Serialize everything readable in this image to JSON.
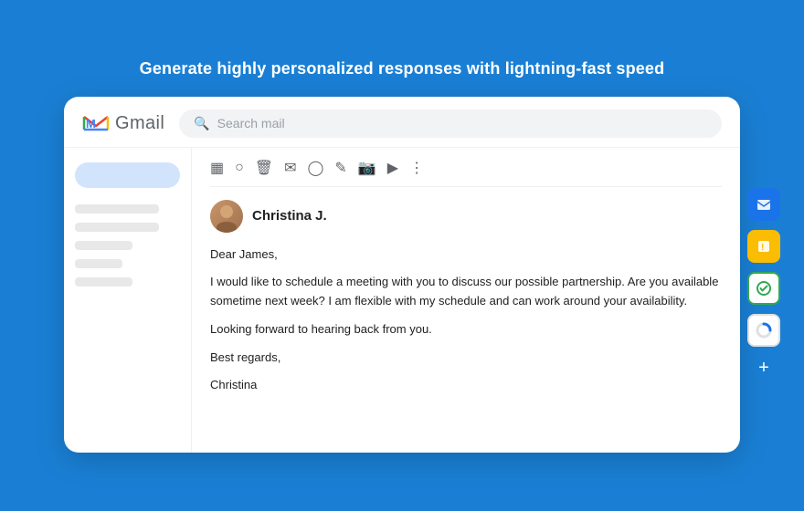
{
  "page": {
    "headline": "Generate highly personalized responses with lightning-fast speed",
    "gmail": {
      "label": "Gmail",
      "search_placeholder": "Search mail",
      "toolbar_icons": [
        "archive",
        "report",
        "delete",
        "mail",
        "clock",
        "edit",
        "attach",
        "label",
        "more"
      ],
      "sender_name": "Christina J.",
      "email_body": {
        "greeting": "Dear James,",
        "paragraph1": "I would like to schedule a meeting with you to discuss our possible partnership. Are you available sometime next week? I am flexible with my schedule and can work around your availability.",
        "paragraph2": "Looking forward to hearing back from you.",
        "closing": "Best regards,",
        "signature": "Christina"
      }
    },
    "right_icons": [
      {
        "name": "gmail-icon",
        "color": "blue"
      },
      {
        "name": "notification-icon",
        "color": "yellow"
      },
      {
        "name": "task-icon",
        "color": "teal"
      },
      {
        "name": "spinner-icon",
        "color": "spinner"
      }
    ],
    "plus_label": "+"
  }
}
